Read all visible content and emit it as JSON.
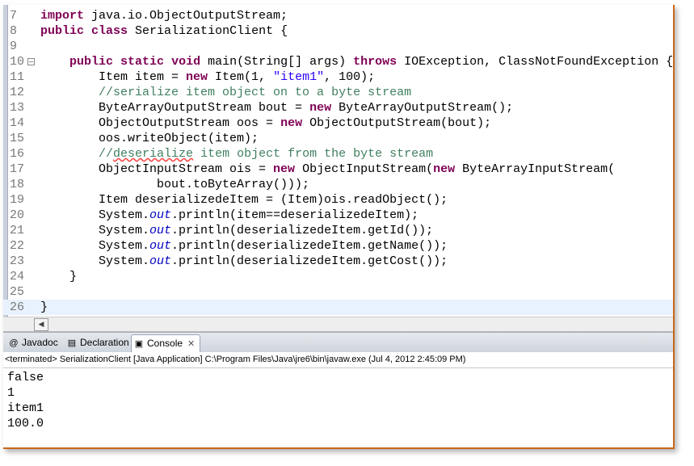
{
  "editor": {
    "lines": [
      {
        "num": "7",
        "segments": [
          {
            "t": "import",
            "c": "kw"
          },
          {
            "t": " java.io.ObjectOutputStream;",
            "c": ""
          }
        ]
      },
      {
        "num": "8",
        "segments": [
          {
            "t": "public",
            "c": "kw"
          },
          {
            "t": " ",
            "c": ""
          },
          {
            "t": "class",
            "c": "kw"
          },
          {
            "t": " SerializationClient {",
            "c": ""
          }
        ]
      },
      {
        "num": "9",
        "segments": []
      },
      {
        "num": "10",
        "fold": "−",
        "segments": [
          {
            "t": "    ",
            "c": ""
          },
          {
            "t": "public",
            "c": "kw"
          },
          {
            "t": " ",
            "c": ""
          },
          {
            "t": "static",
            "c": "kw"
          },
          {
            "t": " ",
            "c": ""
          },
          {
            "t": "void",
            "c": "kw"
          },
          {
            "t": " main(String[] args) ",
            "c": ""
          },
          {
            "t": "throws",
            "c": "kw"
          },
          {
            "t": " IOException, ClassNotFoundException {",
            "c": ""
          }
        ]
      },
      {
        "num": "11",
        "segments": [
          {
            "t": "        Item item = ",
            "c": ""
          },
          {
            "t": "new",
            "c": "kw"
          },
          {
            "t": " Item(1, ",
            "c": ""
          },
          {
            "t": "\"item1\"",
            "c": "st"
          },
          {
            "t": ", 100);",
            "c": ""
          }
        ]
      },
      {
        "num": "12",
        "segments": [
          {
            "t": "        ",
            "c": ""
          },
          {
            "t": "//serialize item object on to a byte stream",
            "c": "cm"
          }
        ]
      },
      {
        "num": "13",
        "segments": [
          {
            "t": "        ByteArrayOutputStream bout = ",
            "c": ""
          },
          {
            "t": "new",
            "c": "kw"
          },
          {
            "t": " ByteArrayOutputStream();",
            "c": ""
          }
        ]
      },
      {
        "num": "14",
        "segments": [
          {
            "t": "        ObjectOutputStream oos = ",
            "c": ""
          },
          {
            "t": "new",
            "c": "kw"
          },
          {
            "t": " ObjectOutputStream(bout);",
            "c": ""
          }
        ]
      },
      {
        "num": "15",
        "segments": [
          {
            "t": "        oos.writeObject(item);",
            "c": ""
          }
        ]
      },
      {
        "num": "16",
        "segments": [
          {
            "t": "        ",
            "c": ""
          },
          {
            "t": "//",
            "c": "cm"
          },
          {
            "t": "deserialize",
            "c": "cm sq"
          },
          {
            "t": " item object from the byte stream",
            "c": "cm"
          }
        ]
      },
      {
        "num": "17",
        "segments": [
          {
            "t": "        ObjectInputStream ois = ",
            "c": ""
          },
          {
            "t": "new",
            "c": "kw"
          },
          {
            "t": " ObjectInputStream(",
            "c": ""
          },
          {
            "t": "new",
            "c": "kw"
          },
          {
            "t": " ByteArrayInputStream(",
            "c": ""
          }
        ]
      },
      {
        "num": "18",
        "segments": [
          {
            "t": "                bout.toByteArray()));",
            "c": ""
          }
        ]
      },
      {
        "num": "19",
        "segments": [
          {
            "t": "        Item deserializedeItem = (Item)ois.readObject();",
            "c": ""
          }
        ]
      },
      {
        "num": "20",
        "segments": [
          {
            "t": "        System.",
            "c": ""
          },
          {
            "t": "out",
            "c": "fd"
          },
          {
            "t": ".println(item==deserializedeItem);",
            "c": ""
          }
        ]
      },
      {
        "num": "21",
        "segments": [
          {
            "t": "        System.",
            "c": ""
          },
          {
            "t": "out",
            "c": "fd"
          },
          {
            "t": ".println(deserializedeItem.getId());",
            "c": ""
          }
        ]
      },
      {
        "num": "22",
        "segments": [
          {
            "t": "        System.",
            "c": ""
          },
          {
            "t": "out",
            "c": "fd"
          },
          {
            "t": ".println(deserializedeItem.getName());",
            "c": ""
          }
        ]
      },
      {
        "num": "23",
        "segments": [
          {
            "t": "        System.",
            "c": ""
          },
          {
            "t": "out",
            "c": "fd"
          },
          {
            "t": ".println(deserializedeItem.getCost());",
            "c": ""
          }
        ]
      },
      {
        "num": "24",
        "segments": [
          {
            "t": "    }",
            "c": ""
          }
        ]
      },
      {
        "num": "25",
        "segments": []
      },
      {
        "num": "26",
        "current": true,
        "segments": [
          {
            "t": "}",
            "c": ""
          }
        ]
      }
    ]
  },
  "scrollbar": {
    "left_arrow": "◀"
  },
  "tabs": [
    {
      "label": "Javadoc",
      "icon": "@",
      "active": false
    },
    {
      "label": "Declaration",
      "icon": "▤",
      "active": false
    },
    {
      "label": "Console",
      "icon": "▣",
      "active": true,
      "close": "✕"
    }
  ],
  "console": {
    "header": "<terminated> SerializationClient [Java Application] C:\\Program Files\\Java\\jre6\\bin\\javaw.exe (Jul 4, 2012 2:45:09 PM)",
    "output": [
      "false",
      "1",
      "item1",
      "100.0"
    ]
  },
  "colors": {
    "keyword": "#7f0055",
    "comment": "#3f7f5f",
    "string": "#2a00ff",
    "field": "#0000c0",
    "current_line": "#e8f2fe"
  }
}
